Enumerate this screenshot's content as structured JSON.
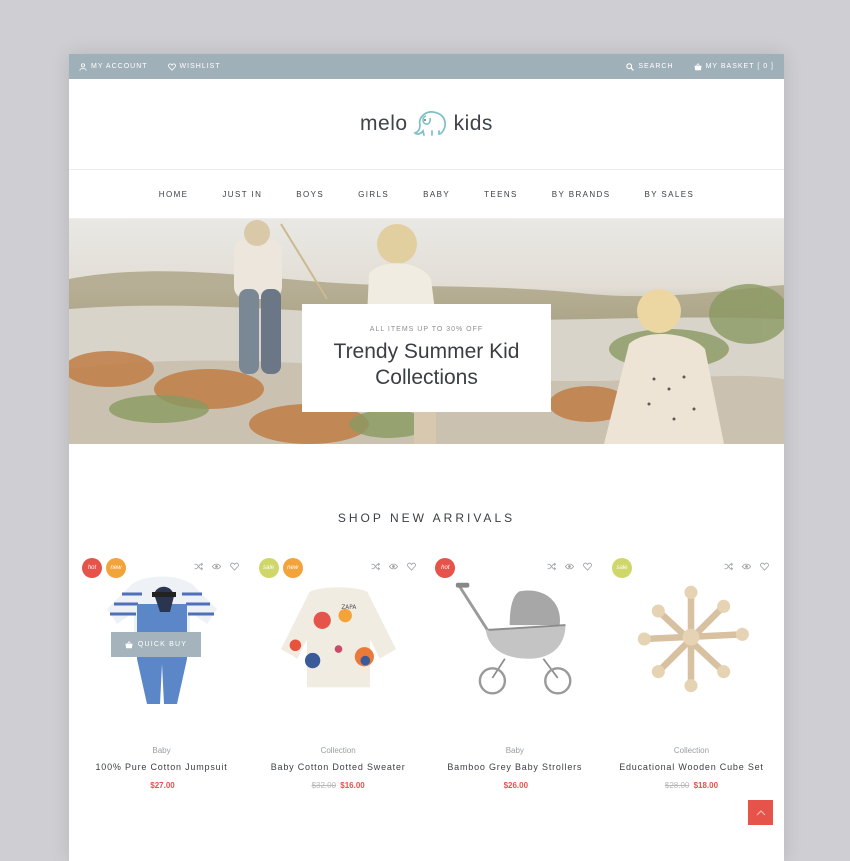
{
  "topbar": {
    "account": "MY ACCOUNT",
    "wishlist": "WISHLIST",
    "search": "SEARCH",
    "basket": "MY BASKET [ 0 ]"
  },
  "logo": {
    "left": "melo",
    "right": "kids",
    "icon": "elephant-icon"
  },
  "nav": [
    "HOME",
    "JUST IN",
    "BOYS",
    "GIRLS",
    "BABY",
    "TEENS",
    "BY BRANDS",
    "BY SALES"
  ],
  "hero": {
    "kicker": "ALL ITEMS UP TO 30% OFF",
    "line1": "Trendy Summer Kid",
    "line2": "Collections"
  },
  "section": {
    "title": "SHOP NEW ARRIVALS"
  },
  "quick_buy": "QUICK BUY",
  "products": [
    {
      "category": "Baby",
      "name": "100% Pure Cotton Jumpsuit",
      "old_price": "",
      "price": "$27.00",
      "badges": [
        "hot",
        "new"
      ]
    },
    {
      "category": "Collection",
      "name": "Baby Cotton Dotted Sweater",
      "old_price": "$32.00",
      "price": "$16.00",
      "badges": [
        "sale",
        "new"
      ]
    },
    {
      "category": "Baby",
      "name": "Bamboo Grey Baby Strollers",
      "old_price": "",
      "price": "$26.00",
      "badges": [
        "hot"
      ]
    },
    {
      "category": "Collection",
      "name": "Educational Wooden Cube Set",
      "old_price": "$28.00",
      "price": "$18.00",
      "badges": [
        "sale"
      ]
    }
  ],
  "colors": {
    "topbar": "#9fb0b9",
    "hot": "#e5534b",
    "new": "#f2a33a",
    "sale": "#cfd66a",
    "price": "#e5534b",
    "quick_buy": "#a4b3bc"
  },
  "icons": {
    "account": "user-icon",
    "wishlist": "heart-icon",
    "search": "search-icon",
    "basket": "basket-icon",
    "compare": "shuffle-icon",
    "view": "eye-icon",
    "wish": "heart-icon",
    "to_top": "arrow-up-icon"
  }
}
